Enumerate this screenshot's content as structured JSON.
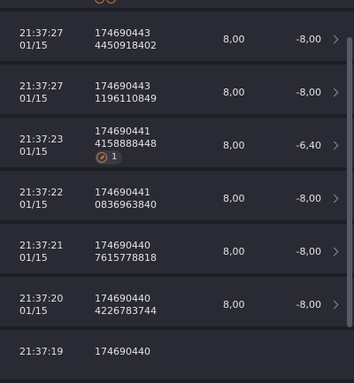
{
  "rows": [
    {
      "time": "",
      "date": "",
      "id1": "",
      "id2": "",
      "amount": "",
      "net": "",
      "partial_icons": true
    },
    {
      "time": "21:37:27",
      "date": "01/15",
      "id1": "174690443",
      "id2": "4450918402",
      "amount": "8,00",
      "net": "-8,00"
    },
    {
      "time": "21:37:27",
      "date": "01/15",
      "id1": "174690443",
      "id2": "1196110849",
      "amount": "8,00",
      "net": "-8,00"
    },
    {
      "time": "21:37:23",
      "date": "01/15",
      "id1": "174690441",
      "id2": "4158888448",
      "amount": "8,00",
      "net": "-6,40",
      "badge_count": "1"
    },
    {
      "time": "21:37:22",
      "date": "01/15",
      "id1": "174690441",
      "id2": "0836963840",
      "amount": "8,00",
      "net": "-8,00"
    },
    {
      "time": "21:37:21",
      "date": "01/15",
      "id1": "174690440",
      "id2": "7615778818",
      "amount": "8,00",
      "net": "-8,00"
    },
    {
      "time": "21:37:20",
      "date": "01/15",
      "id1": "174690440",
      "id2": "4226783744",
      "amount": "8,00",
      "net": "-8,00"
    },
    {
      "time": "21:37:19",
      "date": "",
      "id1": "174690440",
      "id2": "",
      "amount": "",
      "net": ""
    }
  ],
  "colors": {
    "background": "#1e1e26",
    "row": "#2a2a34",
    "accent": "#c77b3a"
  }
}
